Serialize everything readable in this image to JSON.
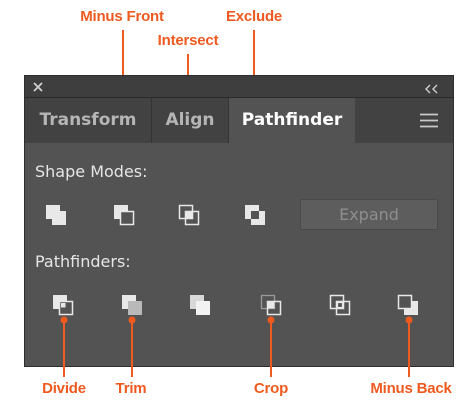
{
  "callouts": {
    "minus_front": "Minus Front",
    "intersect": "Intersect",
    "exclude": "Exclude",
    "divide": "Divide",
    "trim": "Trim",
    "crop": "Crop",
    "minus_back": "Minus Back"
  },
  "panel": {
    "tabs": [
      {
        "label": "Transform",
        "active": false
      },
      {
        "label": "Align",
        "active": false
      },
      {
        "label": "Pathfinder",
        "active": true
      }
    ],
    "shape_modes": {
      "label": "Shape Modes:",
      "expand_label": "Expand"
    },
    "pathfinders": {
      "label": "Pathfinders:"
    }
  },
  "colors": {
    "accent": "#ee5a1f",
    "panel_bg": "#535353",
    "tab_bar": "#424242",
    "title_bar": "#3e3e3e"
  }
}
